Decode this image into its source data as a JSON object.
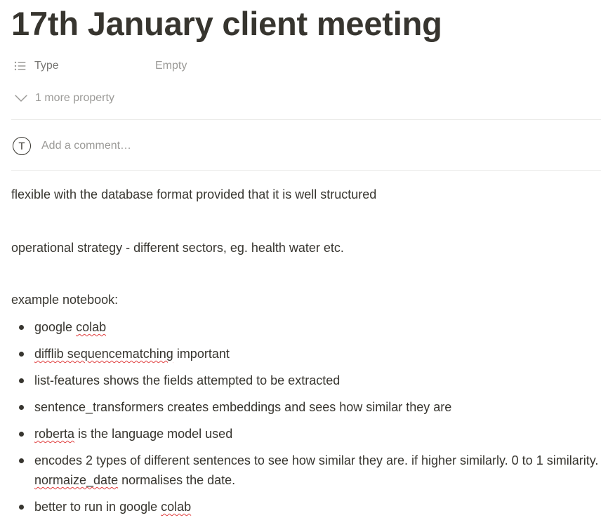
{
  "page": {
    "title": "17th January client meeting"
  },
  "properties": {
    "type_label": "Type",
    "type_value": "Empty",
    "type_icon": "list-icon",
    "more_label": "1 more property",
    "more_icon": "chevron-down-icon"
  },
  "comment": {
    "avatar_initial": "T",
    "placeholder": "Add a comment…"
  },
  "content": {
    "para1": "flexible with the database format provided that it is well structured",
    "para2": "operational strategy - different sectors, eg. health water etc.",
    "para3": "example notebook:",
    "bullets": [
      {
        "pre": "google ",
        "err": "colab",
        "post": ""
      },
      {
        "pre": "",
        "err": "difflib sequencematching",
        "post": " important"
      },
      {
        "pre": "list-features shows the fields attempted to be extracted",
        "err": "",
        "post": ""
      },
      {
        "pre": "sentence_transformers creates embeddings and sees how similar they are",
        "err": "",
        "post": ""
      },
      {
        "pre": "",
        "err": "roberta",
        "post": " is the language model used"
      },
      {
        "pre": "encodes 2 types of different sentences to see how similar they are. if higher similarly. 0 to 1 similarity. ",
        "err": "normaize_date",
        "post": " normalises the date."
      },
      {
        "pre": "better to run in google ",
        "err": "colab",
        "post": ""
      }
    ]
  },
  "colors": {
    "text": "#37352f",
    "muted": "#9b9a97",
    "divider": "#e9e9e7",
    "spellcheck": "#e03e3e"
  }
}
